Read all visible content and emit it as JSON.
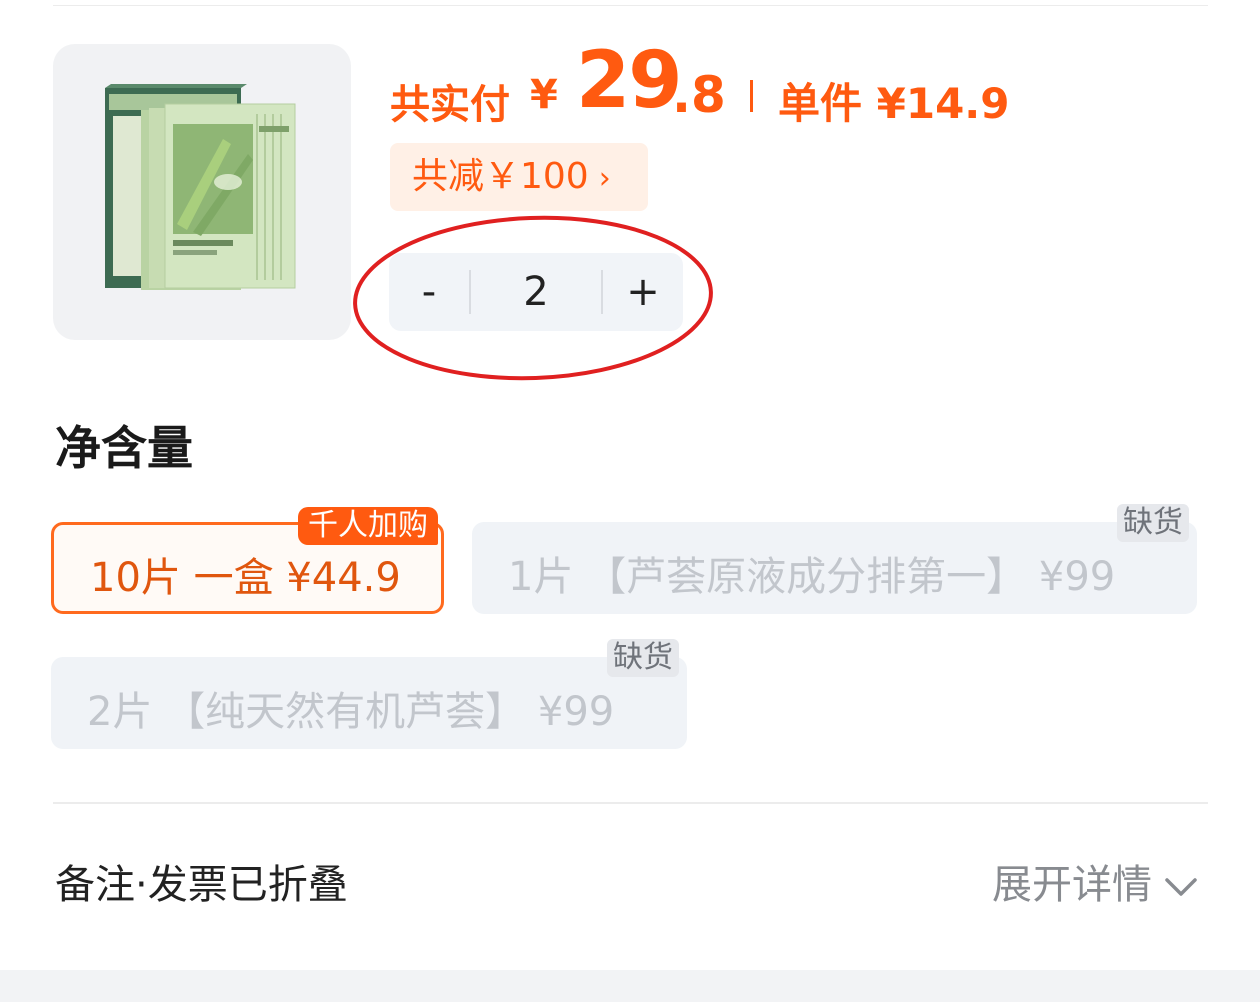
{
  "price": {
    "total_label": "共实付",
    "currency": "¥",
    "total_int": "29",
    "total_dec": ".8",
    "unit_text": "单件 ¥14.9",
    "color": "#ff5a10"
  },
  "discount": {
    "text": "共减￥100",
    "chevron": "›"
  },
  "stepper": {
    "minus": "-",
    "quantity": "2",
    "plus": "+"
  },
  "spec": {
    "title": "净含量",
    "options": [
      {
        "label": "10片 一盒  ¥44.9",
        "badge": "千人加购",
        "selected": true
      },
      {
        "label": "1片 【芦荟原液成分排第一】 ¥99",
        "badge": "缺货",
        "selected": false
      },
      {
        "label": "2片 【纯天然有机芦荟】 ¥99",
        "badge": "缺货",
        "selected": false
      }
    ]
  },
  "remark": {
    "label": "备注·发票已折叠",
    "expand": "展开详情"
  },
  "icons": {
    "expand": "chevron-down-icon"
  },
  "colors": {
    "accent": "#ff5a10",
    "annotation": "#e02020"
  }
}
